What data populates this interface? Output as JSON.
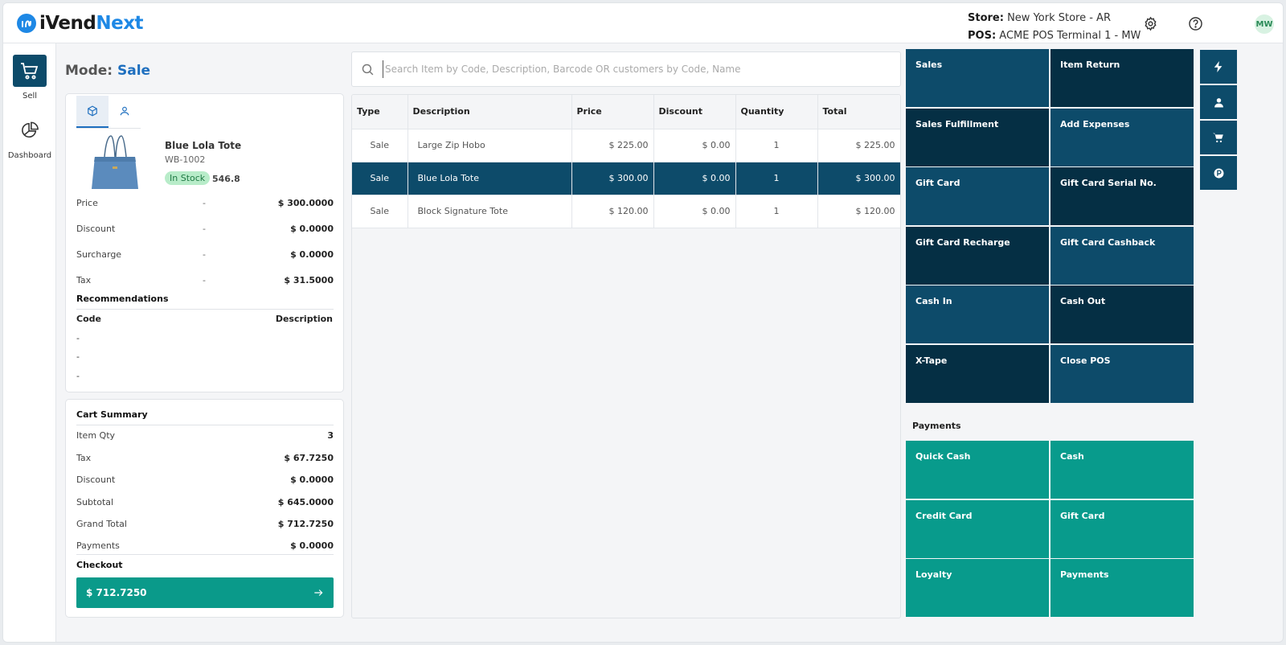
{
  "header": {
    "logo_i": "i",
    "logo_vend": "Vend",
    "logo_next": "Next",
    "store_label": "Store:",
    "store_value": "New York Store - AR",
    "pos_label": "POS:",
    "pos_value": "ACME POS Terminal 1 - MW",
    "avatar": "MW",
    "icons": [
      "gear-icon",
      "help-icon"
    ]
  },
  "nav": {
    "items": [
      {
        "label": "Sell",
        "icon": "cart-icon"
      },
      {
        "label": "Dashboard",
        "icon": "pie-chart-icon"
      }
    ]
  },
  "mode": {
    "label": "Mode:",
    "value": "Sale"
  },
  "product": {
    "name": "Blue Lola Tote",
    "code": "WB-1002",
    "stock_status": "In Stock",
    "stock_qty": "546.8",
    "rows": [
      {
        "label": "Price",
        "dash": "-",
        "value": "$ 300.0000"
      },
      {
        "label": "Discount",
        "dash": "-",
        "value": "$ 0.0000"
      },
      {
        "label": "Surcharge",
        "dash": "-",
        "value": "$ 0.0000"
      },
      {
        "label": "Tax",
        "dash": "-",
        "value": "$ 31.5000"
      }
    ],
    "recommendations_title": "Recommendations",
    "rec_code_header": "Code",
    "rec_desc_header": "Description",
    "rec_rows": [
      "-",
      "-",
      "-"
    ]
  },
  "cart": {
    "title": "Cart Summary",
    "rows": [
      {
        "label": "Item Qty",
        "value": "3"
      },
      {
        "label": "Tax",
        "value": "$ 67.7250"
      },
      {
        "label": "Discount",
        "value": "$ 0.0000"
      },
      {
        "label": "Subtotal",
        "value": "$ 645.0000"
      },
      {
        "label": "Grand Total",
        "value": "$ 712.7250"
      },
      {
        "label": "Payments",
        "value": "$ 0.0000"
      }
    ],
    "checkout_label": "Checkout",
    "checkout_amount": "$ 712.7250"
  },
  "search": {
    "placeholder": "Search Item by Code, Description, Barcode OR customers by Code, Name",
    "value": ""
  },
  "table": {
    "headers": [
      "Type",
      "Description",
      "Price",
      "Discount",
      "Quantity",
      "Total"
    ],
    "rows": [
      {
        "type": "Sale",
        "description": "Large Zip Hobo",
        "price": "$ 225.00",
        "discount": "$ 0.00",
        "quantity": "1",
        "total": "$ 225.00",
        "selected": false
      },
      {
        "type": "Sale",
        "description": "Blue Lola Tote",
        "price": "$ 300.00",
        "discount": "$ 0.00",
        "quantity": "1",
        "total": "$ 300.00",
        "selected": true
      },
      {
        "type": "Sale",
        "description": "Block Signature Tote",
        "price": "$ 120.00",
        "discount": "$ 0.00",
        "quantity": "1",
        "total": "$ 120.00",
        "selected": false
      }
    ]
  },
  "actions": [
    "Sales",
    "Item Return",
    "Sales Fulfillment",
    "Add Expenses",
    "Gift Card",
    "Gift Card Serial No.",
    "Gift Card Recharge",
    "Gift Card Cashback",
    "Cash In",
    "Cash Out",
    "X-Tape",
    "Close POS"
  ],
  "payments": {
    "title": "Payments",
    "items": [
      "Quick Cash",
      "Cash",
      "Credit Card",
      "Gift Card",
      "Loyalty",
      "Payments"
    ]
  },
  "side_buttons": [
    "lightning-icon",
    "user-icon",
    "cart-icon",
    "loyalty-p-icon"
  ],
  "colors": {
    "primary": "#0d4b6a",
    "primary_dark": "#052f44",
    "payment": "#089b8c",
    "accent_blue": "#1e88e5",
    "in_stock_bg": "#b8ecc9"
  }
}
